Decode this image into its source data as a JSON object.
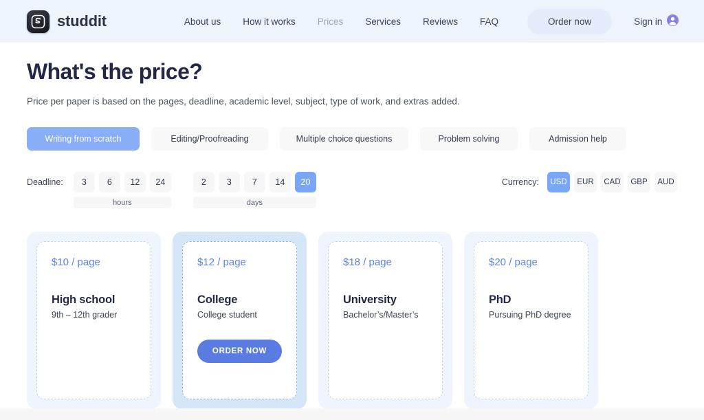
{
  "header": {
    "brand_name": "studdit",
    "brand_mark_icon": "studdit-s-logo-icon",
    "nav": [
      {
        "label": "About us",
        "muted": false
      },
      {
        "label": "How it works",
        "muted": false
      },
      {
        "label": "Prices",
        "muted": true
      },
      {
        "label": "Services",
        "muted": false
      },
      {
        "label": "Reviews",
        "muted": false
      },
      {
        "label": "FAQ",
        "muted": false
      }
    ],
    "order_now_label": "Order now",
    "signin_label": "Sign in",
    "signin_icon": "user-avatar-icon",
    "background_color": "#EEF4FC",
    "pill_color": "#E4EDFB",
    "avatar_color": "#8A7FE8"
  },
  "hero": {
    "title": "What's the price?",
    "subtitle": "Price per paper is based on the pages, deadline, academic level, subject, type of work, and extras added."
  },
  "work_types": {
    "active_index": 0,
    "active_color": "#87AEF7",
    "items": [
      {
        "label": "Writing from scratch"
      },
      {
        "label": "Editing/Proofreading"
      },
      {
        "label": "Multiple choice questions"
      },
      {
        "label": "Problem solving"
      },
      {
        "label": "Admission help"
      }
    ]
  },
  "deadline": {
    "label": "Deadline:",
    "selected_value": "20",
    "selected_unit": "days",
    "selected_color": "#79A6F6",
    "groups": [
      {
        "unit": "hours",
        "values": [
          "3",
          "6",
          "12",
          "24"
        ]
      },
      {
        "unit": "days",
        "values": [
          "2",
          "3",
          "7",
          "14",
          "20"
        ]
      }
    ]
  },
  "currency": {
    "label": "Currency:",
    "selected": "USD",
    "selected_color": "#79A6F6",
    "options": [
      "USD",
      "EUR",
      "CAD",
      "GBP",
      "AUD"
    ]
  },
  "price_cards": [
    {
      "price": "$10 / page",
      "level": "High school",
      "description": "9th – 12th grader",
      "featured": false,
      "order_label": null
    },
    {
      "price": "$12 / page",
      "level": "College",
      "description": "College student",
      "featured": true,
      "order_label": "ORDER NOW"
    },
    {
      "price": "$18 / page",
      "level": "University",
      "description": "Bachelor’s/Master’s",
      "featured": false,
      "order_label": null
    },
    {
      "price": "$20 / page",
      "level": "PhD",
      "description": "Pursuing PhD degree",
      "featured": false,
      "order_label": null
    }
  ],
  "theme": {
    "card_bg": "#EFF5FE",
    "card_bg_featured": "#D5E6F9",
    "price_text": "#5F83E8",
    "order_button": "#5A7CE0",
    "heading": "#232945"
  }
}
